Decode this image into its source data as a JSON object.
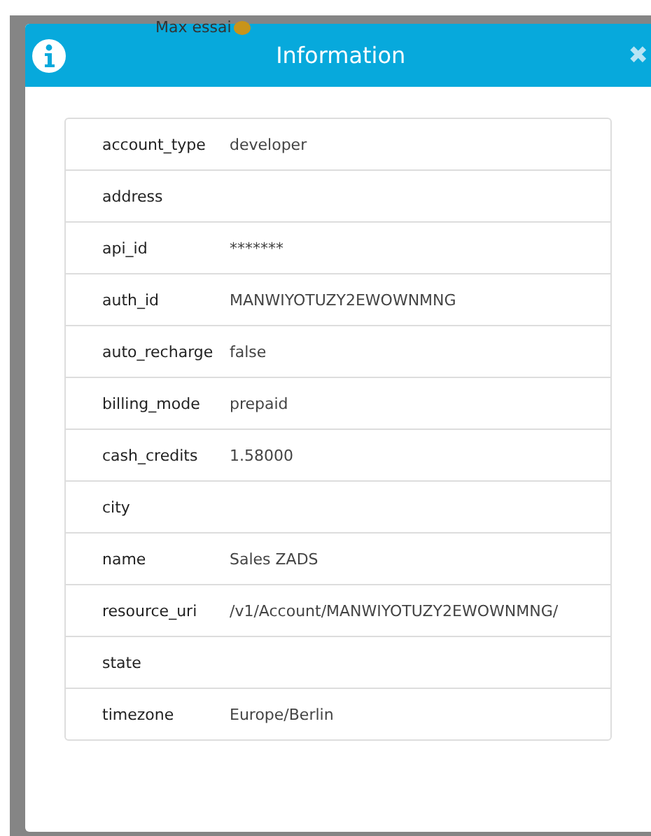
{
  "background": {
    "text": "Max essai"
  },
  "dialog": {
    "title": "Information",
    "close": "✖"
  },
  "rows": [
    {
      "key": "account_type",
      "value": "developer"
    },
    {
      "key": "address",
      "value": ""
    },
    {
      "key": "api_id",
      "value": "*******"
    },
    {
      "key": "auth_id",
      "value": "MANWIYOTUZY2EWOWNMNG"
    },
    {
      "key": "auto_recharge",
      "value": "false"
    },
    {
      "key": "billing_mode",
      "value": "prepaid"
    },
    {
      "key": "cash_credits",
      "value": "1.58000"
    },
    {
      "key": "city",
      "value": ""
    },
    {
      "key": "name",
      "value": "Sales ZADS"
    },
    {
      "key": "resource_uri",
      "value": "/v1/Account/MANWIYOTUZY2EWOWNMNG/"
    },
    {
      "key": "state",
      "value": ""
    },
    {
      "key": "timezone",
      "value": "Europe/Berlin"
    }
  ]
}
